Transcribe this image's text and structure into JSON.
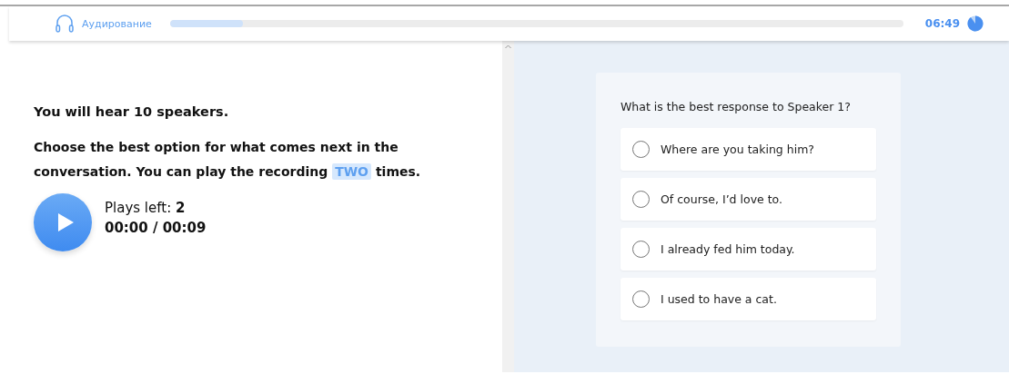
{
  "header": {
    "section": "Аудирование",
    "progress": {
      "level": 0.1
    },
    "timer": "06:49"
  },
  "instructions": {
    "heading": "You will hear 10 speakers.",
    "body": [
      {
        "text": "Choose the best option for what comes next in the conversation. You can play the recording ",
        "highlight": false
      },
      {
        "text": "TWO",
        "highlight": true
      },
      {
        "text": " times.",
        "highlight": false
      }
    ]
  },
  "player": {
    "plays_left": "Plays left: **2**",
    "time": "00:00 / 00:09"
  },
  "question": {
    "prompt": "What is the best response to Speaker 1?",
    "options": [
      {
        "text": "Where are you taking him?",
        "selected": false
      },
      {
        "text": "Of course, I’d love to.",
        "selected": false
      },
      {
        "text": "I already fed him today.",
        "selected": false
      },
      {
        "text": "I used to have a cat.",
        "selected": false
      }
    ]
  }
}
